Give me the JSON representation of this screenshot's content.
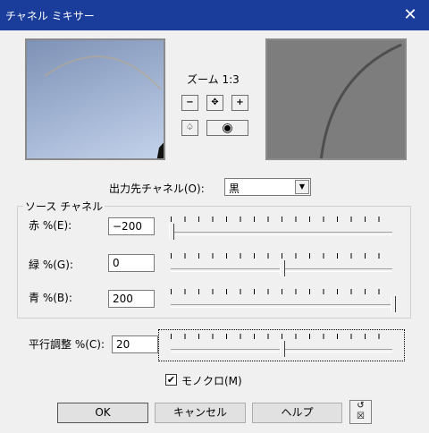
{
  "window": {
    "title": "チャネル ミキサー",
    "close_glyph": "✕"
  },
  "preview": {
    "zoom_label": "ズーム",
    "zoom_value": "1:3",
    "tools": [
      {
        "name": "zoom-out-icon",
        "glyph": "🔍−"
      },
      {
        "name": "pan-icon",
        "glyph": "✥"
      },
      {
        "name": "zoom-in-icon",
        "glyph": "🔍+"
      },
      {
        "name": "hand-icon",
        "glyph": "✋"
      },
      {
        "name": "eye-icon",
        "glyph": "👁"
      }
    ]
  },
  "output": {
    "label": "出力先チャネル(O):",
    "selected": "黒"
  },
  "source": {
    "group_title": "ソース チャネル",
    "channels": [
      {
        "label": "赤 %(E):",
        "value": "−200",
        "slider_percent": 0
      },
      {
        "label": "緑 %(G):",
        "value": "0",
        "slider_percent": 50
      },
      {
        "label": "青 %(B):",
        "value": "200",
        "slider_percent": 100
      }
    ]
  },
  "offset": {
    "label": "平行調整 %(C):",
    "value": "20",
    "slider_percent": 50
  },
  "monochrome": {
    "label": "モノクロ(M)",
    "checked": true,
    "check_glyph": "✔"
  },
  "buttons": {
    "ok": "OK",
    "cancel": "キャンセル",
    "help": "ヘルプ"
  },
  "colors": {
    "titlebar": "#1a3d9c",
    "dialog_bg": "#f0f0f0"
  }
}
